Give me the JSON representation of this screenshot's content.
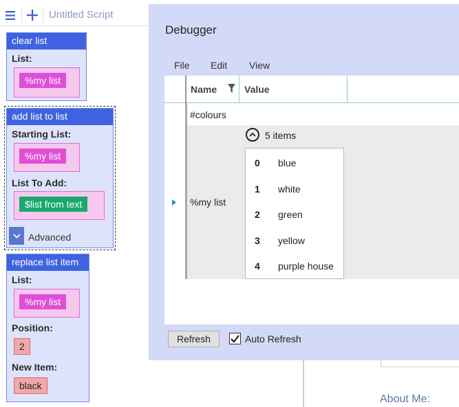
{
  "toolbar": {
    "menu_icon": "hamburger-icon",
    "add_icon": "plus-icon",
    "script_title": "Untitled Script"
  },
  "blocks": {
    "clear_list": {
      "title": "clear list",
      "list_label": "List:",
      "list_value": "%my list"
    },
    "add_list": {
      "title": "add list to list",
      "starting_label": "Starting List:",
      "starting_value": "%my list",
      "to_add_label": "List To Add:",
      "to_add_value": "$list from text",
      "advanced_label": "Advanced"
    },
    "replace_item": {
      "title": "replace list item",
      "list_label": "List:",
      "list_value": "%my list",
      "position_label": "Position:",
      "position_value": "2",
      "new_item_label": "New Item:",
      "new_item_value": "black"
    }
  },
  "background_page": {
    "about_label": "About Me:"
  },
  "debugger": {
    "title": "Debugger",
    "menu": [
      "File",
      "Edit",
      "View"
    ],
    "columns": {
      "name": "Name",
      "value": "Value"
    },
    "rows": [
      {
        "name": "#colours",
        "value": ""
      },
      {
        "name": "%my list",
        "summary": "5 items"
      }
    ],
    "list_items": [
      {
        "index": "0",
        "value": "blue"
      },
      {
        "index": "1",
        "value": "white"
      },
      {
        "index": "2",
        "value": "green"
      },
      {
        "index": "3",
        "value": "yellow"
      },
      {
        "index": "4",
        "value": "purple house"
      }
    ],
    "refresh_label": "Refresh",
    "auto_refresh_label": "Auto Refresh",
    "auto_refresh_checked": true
  },
  "colors": {
    "block_header": "#3f63e0",
    "block_body": "#dde3fb",
    "variable_chip": "#e04ed6",
    "text_chip": "#1aa86d",
    "value_chip": "#f2a9aa",
    "debugger_bg": "#d3daf7",
    "grid_accent": "#8ec8d4"
  }
}
